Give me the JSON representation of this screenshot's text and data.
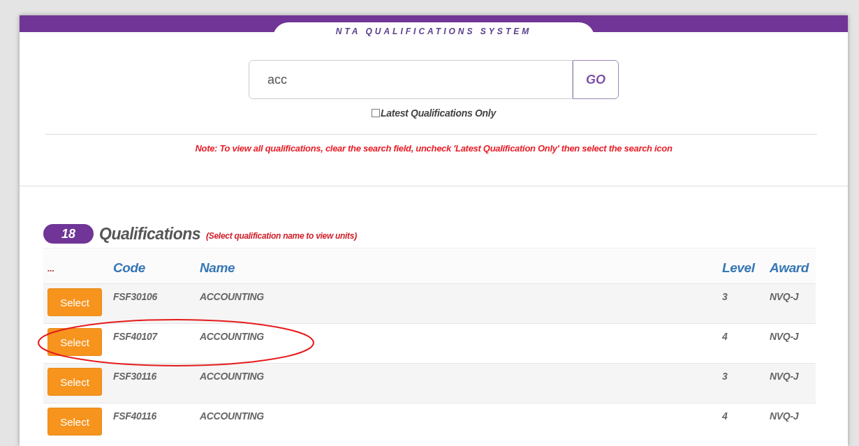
{
  "header": {
    "title": "NTA QUALIFICATIONS SYSTEM"
  },
  "search": {
    "value": "acc",
    "button": "GO",
    "latest_only": {
      "label": "Latest Qualifications Only",
      "checked": false
    }
  },
  "note": "Note: To view all qualifications, clear the search field, uncheck 'Latest Qualification Only' then select the search icon",
  "results": {
    "count": "18",
    "title": "Qualifications",
    "hint": "(Select qualification name to view units)"
  },
  "table": {
    "columns": [
      "...",
      "Code",
      "Name",
      "Level",
      "Award"
    ],
    "rows": [
      {
        "action": "Select",
        "code": "FSF30106",
        "name": "ACCOUNTING",
        "level": "3",
        "award": "NVQ-J"
      },
      {
        "action": "Select",
        "code": "FSF40107",
        "name": "ACCOUNTING",
        "level": "4",
        "award": "NVQ-J"
      },
      {
        "action": "Select",
        "code": "FSF30116",
        "name": "ACCOUNTING",
        "level": "3",
        "award": "NVQ-J"
      },
      {
        "action": "Select",
        "code": "FSF40116",
        "name": "ACCOUNTING",
        "level": "4",
        "award": "NVQ-J"
      }
    ]
  }
}
